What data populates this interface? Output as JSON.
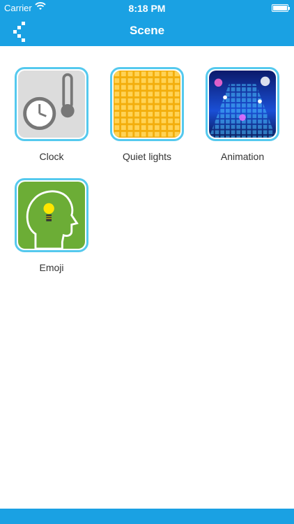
{
  "status_bar": {
    "carrier": "Carrier",
    "time": "8:18 PM"
  },
  "nav": {
    "title": "Scene"
  },
  "scenes": [
    {
      "label": "Clock",
      "icon": "clock-thermometer-icon"
    },
    {
      "label": "Quiet lights",
      "icon": "grid-lights-icon"
    },
    {
      "label": "Animation",
      "icon": "disco-floor-icon"
    },
    {
      "label": "Emoji",
      "icon": "head-lightbulb-icon"
    }
  ],
  "colors": {
    "accent": "#1aa1e3",
    "tile_border": "#55c9ee",
    "quiet_lights": "#f6b40e",
    "emoji_bg": "#6cad36"
  }
}
